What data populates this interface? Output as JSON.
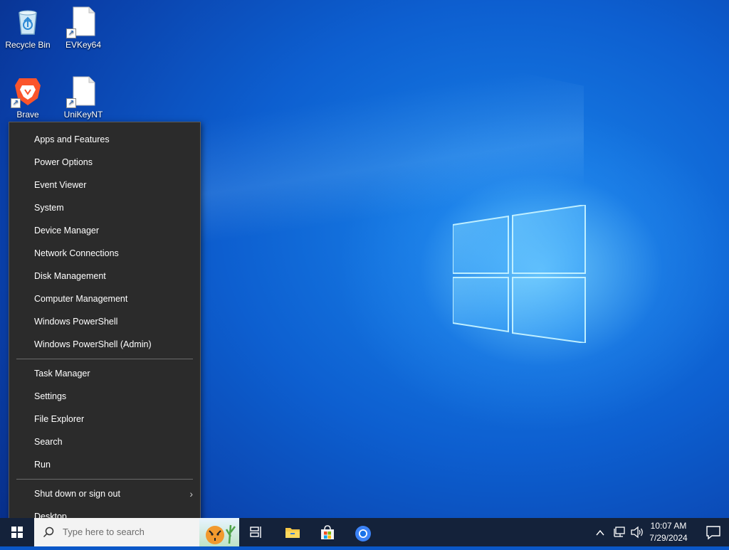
{
  "desktop": {
    "icons": [
      {
        "label": "Recycle Bin",
        "icon": "recycle-bin-icon"
      },
      {
        "label": "EVKey64",
        "icon": "file-shortcut-icon"
      },
      {
        "label": "Brave",
        "icon": "brave-icon"
      },
      {
        "label": "UniKeyNT",
        "icon": "file-shortcut-icon"
      }
    ]
  },
  "context_menu": {
    "group1": [
      "Apps and Features",
      "Power Options",
      "Event Viewer",
      "System",
      "Device Manager",
      "Network Connections",
      "Disk Management",
      "Computer Management",
      "Windows PowerShell",
      "Windows PowerShell (Admin)"
    ],
    "group2": [
      "Task Manager",
      "Settings",
      "File Explorer",
      "Search",
      "Run"
    ],
    "group3": [
      {
        "label": "Shut down or sign out",
        "submenu_arrow": "›"
      },
      {
        "label": "Desktop"
      }
    ]
  },
  "taskbar": {
    "search_placeholder": "Type here to search",
    "pinned": [
      "task-view-icon",
      "file-explorer-icon",
      "microsoft-store-icon",
      "chrome-icon"
    ],
    "tray": {
      "time": "10:07 AM",
      "date": "7/29/2024"
    }
  },
  "colors": {
    "menu_bg": "#2b2b2b",
    "taskbar_bg": "#14223a",
    "desktop_blue": "#0d5fd0"
  }
}
